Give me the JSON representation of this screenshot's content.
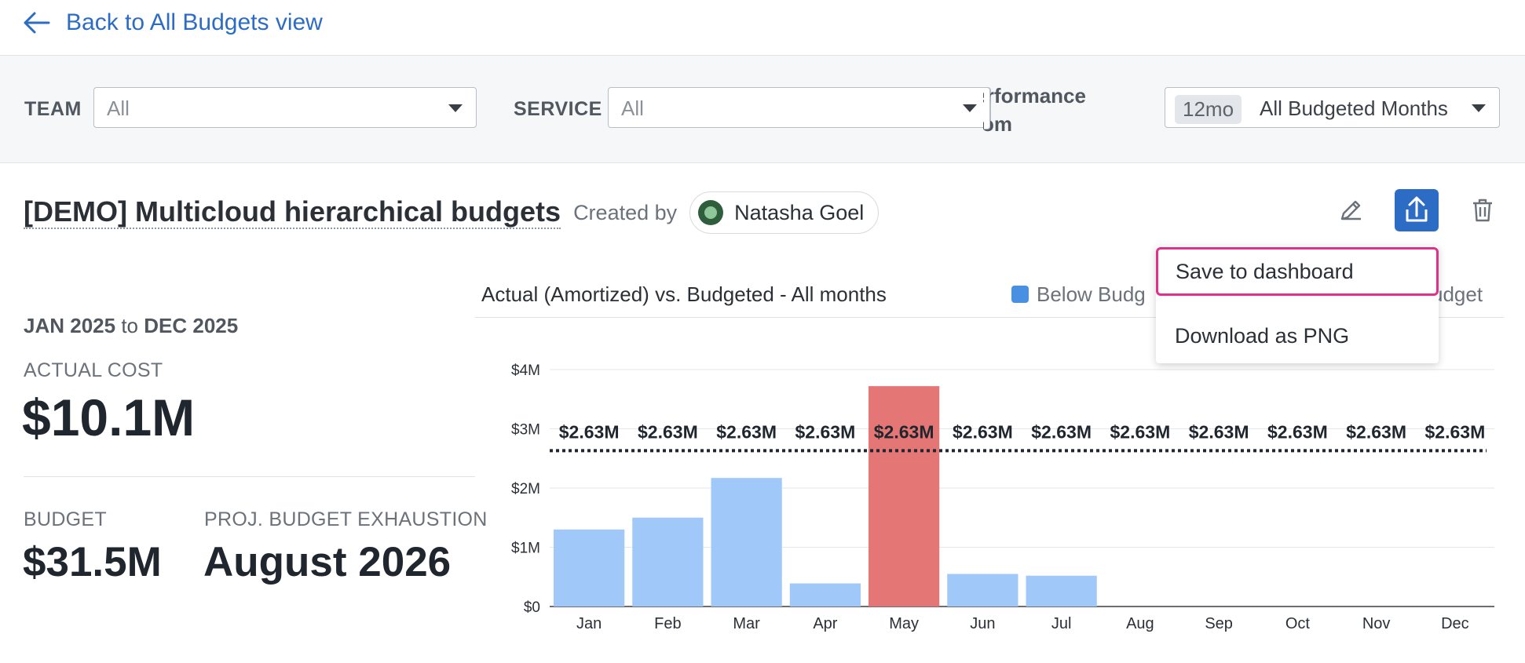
{
  "nav": {
    "back_label": "Back to All Budgets view"
  },
  "filters": {
    "team_label": "TEAM",
    "team_value": "All",
    "service_label": "SERVICE",
    "service_value": "All",
    "performance_label_line1": "Performance",
    "performance_label_line2": "From",
    "period_pill": "12mo",
    "period_value": "All Budgeted Months"
  },
  "budget": {
    "title": "[DEMO] Multicloud hierarchical budgets",
    "created_by_label": "Created by",
    "owner": "Natasha Goel"
  },
  "share_menu": {
    "items": [
      "Save to dashboard",
      "Download as PNG"
    ]
  },
  "stats": {
    "range_start": "JAN 2025",
    "range_to": "to",
    "range_end": "DEC 2025",
    "actual_cost_label": "ACTUAL COST",
    "actual_cost_value": "$10.1M",
    "budget_label": "BUDGET",
    "budget_value": "$31.5M",
    "exhaustion_label": "PROJ. BUDGET EXHAUSTION",
    "exhaustion_value": "August 2026"
  },
  "chart_header": {
    "title": "Actual (Amortized) vs. Budgeted - All months",
    "legend_below": "Below Budg",
    "legend_tail": "udget"
  },
  "colors": {
    "accent": "#2d6cc4",
    "below_budget": "#a0c8f8",
    "over_budget": "#e57676",
    "legend_below": "#4a90e2",
    "highlight": "#e0308b"
  },
  "chart_data": {
    "type": "bar",
    "categories": [
      "Jan",
      "Feb",
      "Mar",
      "Apr",
      "May",
      "Jun",
      "Jul",
      "Aug",
      "Sep",
      "Oct",
      "Nov",
      "Dec"
    ],
    "values": [
      1.3,
      1.5,
      2.17,
      0.39,
      3.72,
      0.55,
      0.52,
      0,
      0,
      0,
      0,
      0
    ],
    "over_budget": [
      false,
      false,
      false,
      false,
      true,
      false,
      false,
      false,
      false,
      false,
      false,
      false
    ],
    "budget_values": [
      2.63,
      2.63,
      2.63,
      2.63,
      2.63,
      2.63,
      2.63,
      2.63,
      2.63,
      2.63,
      2.63,
      2.63
    ],
    "budget_labels": [
      "$2.63M",
      "$2.63M",
      "$2.63M",
      "$2.63M",
      "$2.63M",
      "$2.63M",
      "$2.63M",
      "$2.63M",
      "$2.63M",
      "$2.63M",
      "$2.63M",
      "$2.63M"
    ],
    "ylim": [
      0,
      4
    ],
    "yticks": [
      0,
      1,
      2,
      3,
      4
    ],
    "ytick_labels": [
      "$0",
      "$1M",
      "$2M",
      "$3M",
      "$4M"
    ],
    "grid": true
  }
}
